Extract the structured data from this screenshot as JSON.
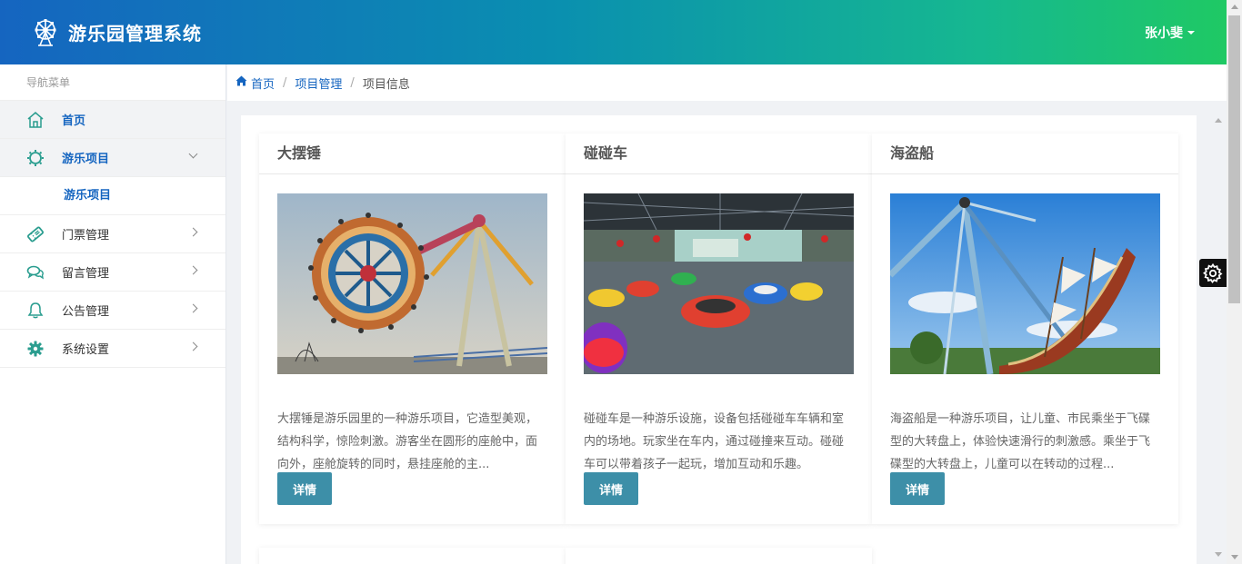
{
  "app": {
    "title": "游乐园管理系统",
    "user_name": "张小斐",
    "colors": {
      "header_from": "#1565c0",
      "header_to": "#1fc964",
      "accent": "#1565c0",
      "button": "#3d8fa8"
    }
  },
  "sidebar": {
    "heading": "导航菜单",
    "items": [
      {
        "label": "首页",
        "icon": "home-icon"
      },
      {
        "label": "游乐项目",
        "icon": "sun-icon",
        "expanded": true,
        "children": [
          {
            "label": "游乐项目"
          }
        ]
      },
      {
        "label": "门票管理",
        "icon": "ticket-icon"
      },
      {
        "label": "留言管理",
        "icon": "chat-icon"
      },
      {
        "label": "公告管理",
        "icon": "bell-icon"
      },
      {
        "label": "系统设置",
        "icon": "gear-icon"
      }
    ]
  },
  "breadcrumb": {
    "home": "首页",
    "section": "项目管理",
    "current": "项目信息"
  },
  "cards": [
    {
      "title": "大摆锤",
      "image": "pendulum-ride-photo",
      "description": "大摆锤是游乐园里的一种游乐项目，它造型美观，结构科学，惊险刺激。游客坐在圆形的座舱中，面向外，座舱旋转的同时，悬挂座舱的主...",
      "button": "详情"
    },
    {
      "title": "碰碰车",
      "image": "bumper-cars-photo",
      "description": "碰碰车是一种游乐设施，设备包括碰碰车车辆和室内的场地。玩家坐在车内，通过碰撞来互动。碰碰车可以带着孩子一起玩，增加互动和乐趣。",
      "button": "详情"
    },
    {
      "title": "海盗船",
      "image": "pirate-ship-photo",
      "description": "海盗船是一种游乐项目，让儿童、市民乘坐于飞碟型的大转盘上，体验快速滑行的刺激感。乘坐于飞碟型的大转盘上，儿童可以在转动的过程...",
      "button": "详情"
    }
  ]
}
